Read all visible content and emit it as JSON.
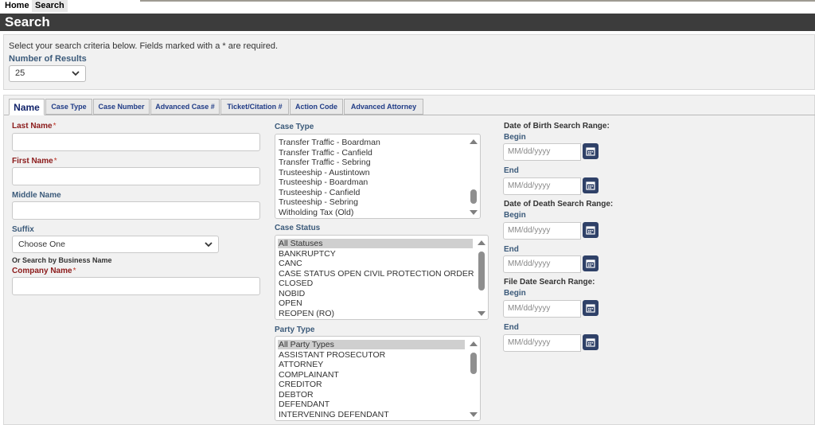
{
  "nav": {
    "home": "Home",
    "search": "Search"
  },
  "title": "Search",
  "criteria": {
    "intro": "Select your search criteria below. Fields marked with a * are required.",
    "num_results_label": "Number of Results",
    "num_results_value": "25"
  },
  "tabs": [
    "Name",
    "Case Type",
    "Case Number",
    "Advanced Case #",
    "Ticket/Citation #",
    "Action Code",
    "Advanced Attorney"
  ],
  "form": {
    "last_name": "Last Name",
    "first_name": "First Name",
    "middle_name": "Middle Name",
    "suffix": "Suffix",
    "suffix_value": "Choose One",
    "business_hint": "Or Search by Business Name",
    "company_name": "Company Name",
    "required_mark": "*"
  },
  "case_type": {
    "label": "Case Type",
    "options": [
      "Transfer Traffic - Boardman",
      "Transfer Traffic - Canfield",
      "Transfer Traffic - Sebring",
      "Trusteeship - Austintown",
      "Trusteeship - Boardman",
      "Trusteeship - Canfield",
      "Trusteeship - Sebring",
      "Witholding Tax (Old)"
    ]
  },
  "case_status": {
    "label": "Case Status",
    "options": [
      "All Statuses",
      "BANKRUPTCY",
      "CANC",
      "CASE STATUS OPEN CIVIL PROTECTION ORDER",
      "CLOSED",
      "NOBID",
      "OPEN",
      "REOPEN (RO)"
    ]
  },
  "party_type": {
    "label": "Party Type",
    "options": [
      "All Party Types",
      "ASSISTANT PROSECUTOR",
      "ATTORNEY",
      "COMPLAINANT",
      "CREDITOR",
      "DEBTOR",
      "DEFENDANT",
      "INTERVENING DEFENDANT"
    ]
  },
  "dates": {
    "dob_label": "Date of Birth Search Range:",
    "dod_label": "Date of Death Search Range:",
    "file_label": "File Date Search Range:",
    "begin": "Begin",
    "end": "End",
    "placeholder": "MM/dd/yyyy"
  }
}
